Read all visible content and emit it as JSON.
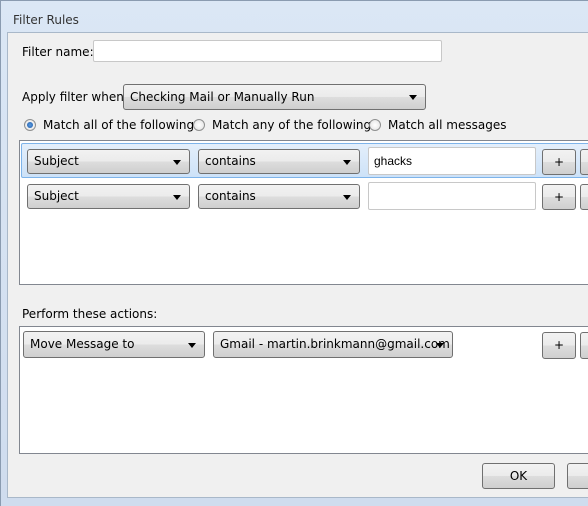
{
  "window": {
    "title": "Filter Rules"
  },
  "filter_name": {
    "label": "Filter name:",
    "value": "",
    "placeholder": ""
  },
  "apply_when": {
    "label": "Apply filter when:",
    "selected": "Checking Mail or Manually Run"
  },
  "match": {
    "options": [
      {
        "label": "Match all of the following",
        "checked": true
      },
      {
        "label": "Match any of the following",
        "checked": false
      },
      {
        "label": "Match all messages",
        "checked": false
      }
    ]
  },
  "conditions": [
    {
      "field": "Subject",
      "operator": "contains",
      "value": "ghacks",
      "add_label": "+",
      "selected": true
    },
    {
      "field": "Subject",
      "operator": "contains",
      "value": "",
      "add_label": "+",
      "selected": false
    }
  ],
  "actions": {
    "label": "Perform these actions:",
    "items": [
      {
        "action": "Move Message to",
        "target": "Gmail - martin.brinkmann@gmail.com",
        "add_label": "+"
      }
    ]
  },
  "footer": {
    "ok_label": "OK"
  }
}
